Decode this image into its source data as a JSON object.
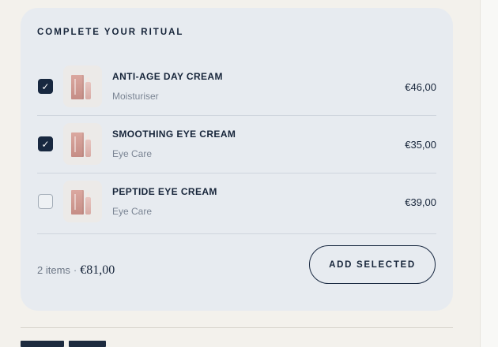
{
  "ritual": {
    "title": "COMPLETE YOUR RITUAL",
    "items": [
      {
        "checked": true,
        "name": "ANTI-AGE DAY CREAM",
        "subtitle": "Moisturiser",
        "price": "€46,00",
        "check_icon": "checkmark-icon",
        "thumb_icon": "product-image"
      },
      {
        "checked": true,
        "name": "SMOOTHING EYE CREAM",
        "subtitle": "Eye Care",
        "price": "€35,00",
        "check_icon": "checkmark-icon",
        "thumb_icon": "product-image"
      },
      {
        "checked": false,
        "name": "PEPTIDE EYE CREAM",
        "subtitle": "Eye Care",
        "price": "€39,00",
        "check_icon": "",
        "thumb_icon": "product-image"
      }
    ],
    "summary": {
      "count": "2 items",
      "separator": "·",
      "total": "€81,00"
    },
    "add_button": "ADD SELECTED"
  },
  "colors": {
    "background": "#f3f1ec",
    "card": "#e7ebf0",
    "text": "#17253a",
    "muted": "#7b8594",
    "checkbox_checked": "#182840",
    "product_pink": "#d29b94"
  }
}
